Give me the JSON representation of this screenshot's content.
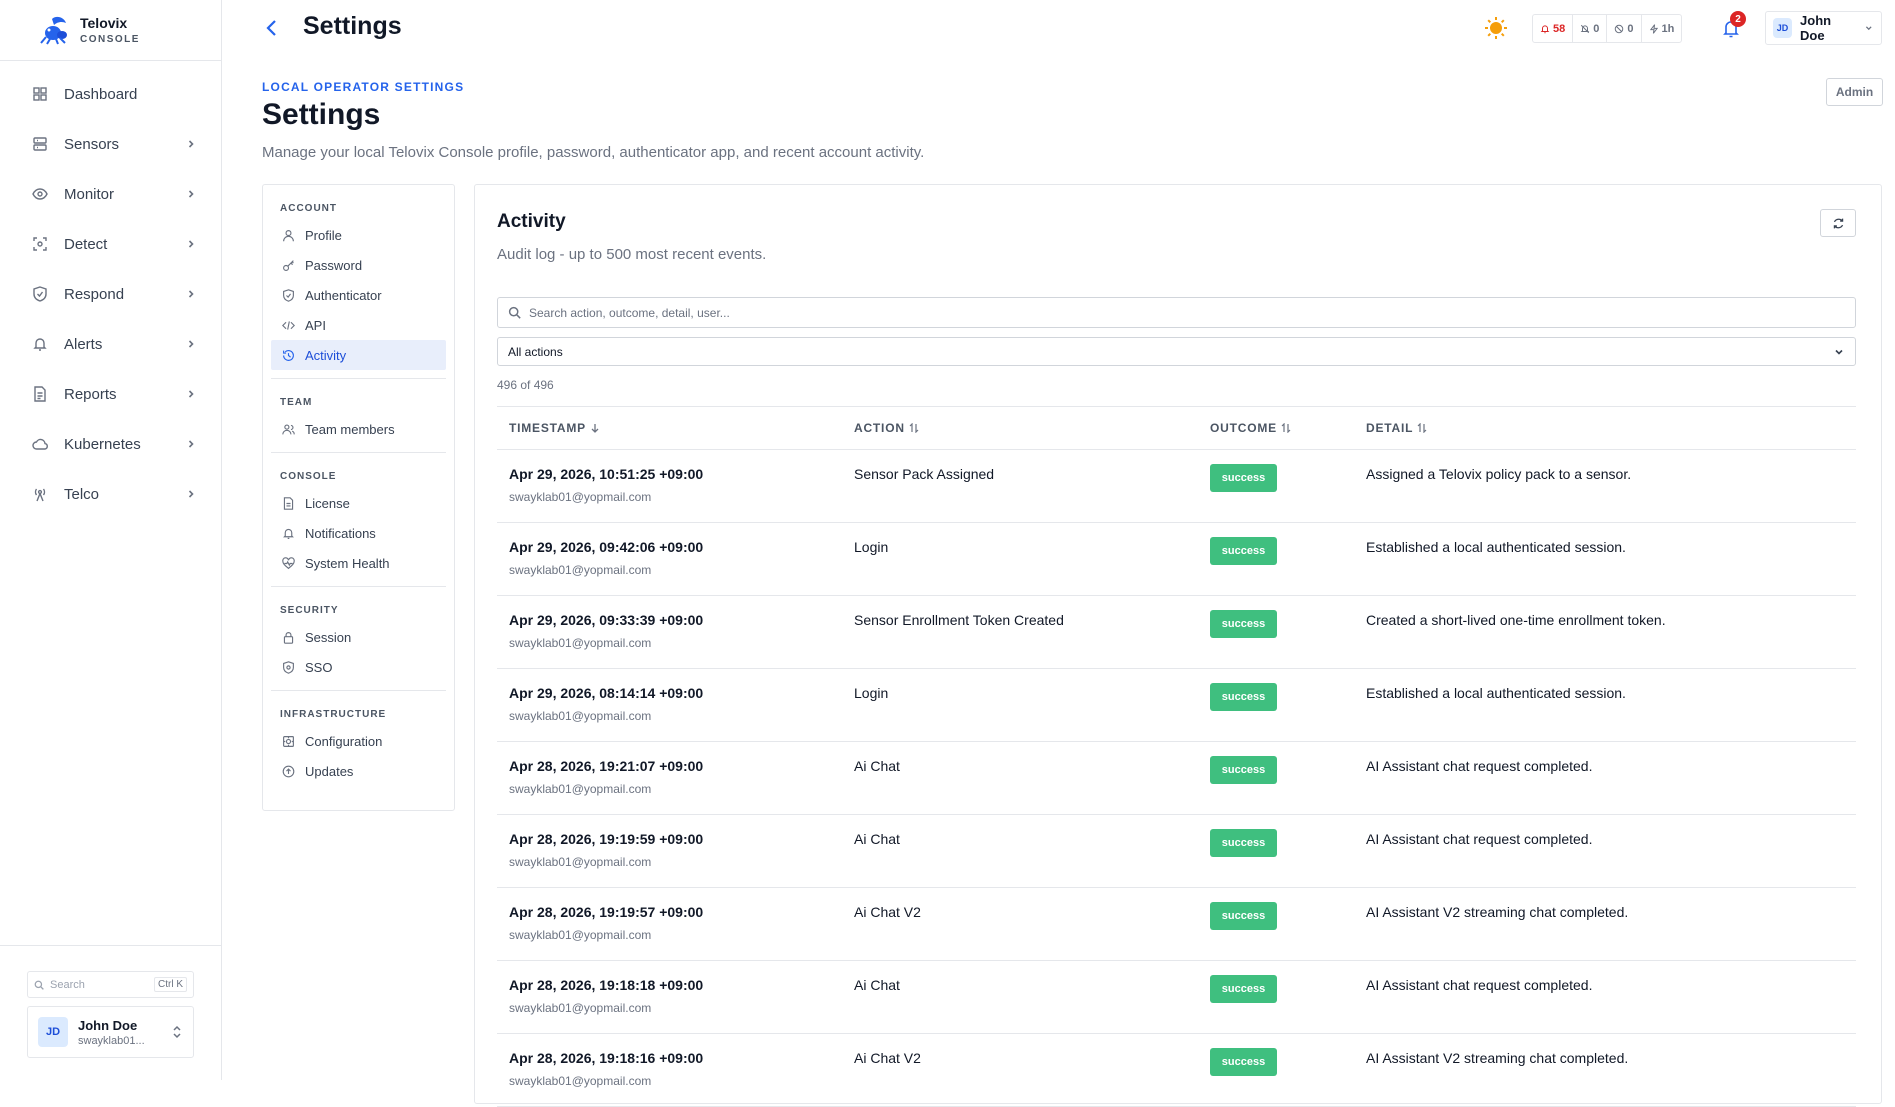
{
  "brand": {
    "name": "Telovix",
    "sub": "CONSOLE"
  },
  "sidebar": {
    "items": [
      {
        "label": "Dashboard",
        "icon": "grid-icon",
        "chevron": false
      },
      {
        "label": "Sensors",
        "icon": "server-icon",
        "chevron": true
      },
      {
        "label": "Monitor",
        "icon": "eye-icon",
        "chevron": true
      },
      {
        "label": "Detect",
        "icon": "scan-icon",
        "chevron": true
      },
      {
        "label": "Respond",
        "icon": "shield-icon",
        "chevron": true
      },
      {
        "label": "Alerts",
        "icon": "bell-icon",
        "chevron": true
      },
      {
        "label": "Reports",
        "icon": "file-icon",
        "chevron": true
      },
      {
        "label": "Kubernetes",
        "icon": "cloud-icon",
        "chevron": true
      },
      {
        "label": "Telco",
        "icon": "antenna-icon",
        "chevron": true
      }
    ],
    "search_placeholder": "Search",
    "search_shortcut": "Ctrl K",
    "user": {
      "initials": "JD",
      "name": "John Doe",
      "email": "swayklab01..."
    }
  },
  "topbar": {
    "title": "Settings",
    "stats": {
      "alerts": "58",
      "muted": "0",
      "blocked": "0",
      "window": "1h"
    },
    "notif_count": "2",
    "user": {
      "initials": "JD",
      "name": "John Doe"
    }
  },
  "header": {
    "eyebrow": "LOCAL OPERATOR SETTINGS",
    "title": "Settings",
    "description": "Manage your local Telovix Console profile, password, authenticator app, and recent account activity.",
    "role": "Admin"
  },
  "settings_nav": {
    "account": {
      "heading": "ACCOUNT",
      "items": [
        "Profile",
        "Password",
        "Authenticator",
        "API",
        "Activity"
      ]
    },
    "team": {
      "heading": "TEAM",
      "items": [
        "Team members"
      ]
    },
    "console": {
      "heading": "CONSOLE",
      "items": [
        "License",
        "Notifications",
        "System Health"
      ]
    },
    "security": {
      "heading": "SECURITY",
      "items": [
        "Session",
        "SSO"
      ]
    },
    "infrastructure": {
      "heading": "INFRASTRUCTURE",
      "items": [
        "Configuration",
        "Updates"
      ]
    },
    "active": "Activity"
  },
  "activity": {
    "title": "Activity",
    "subtitle": "Audit log - up to 500 most recent events.",
    "search_placeholder": "Search action, outcome, detail, user...",
    "filter_value": "All actions",
    "count": "496 of 496",
    "columns": [
      "TIMESTAMP",
      "ACTION",
      "OUTCOME",
      "DETAIL"
    ],
    "rows": [
      {
        "timestamp": "Apr 29, 2026, 10:51:25 +09:00",
        "user": "swayklab01@yopmail.com",
        "action": "Sensor Pack Assigned",
        "outcome": "success",
        "detail": "Assigned a Telovix policy pack to a sensor."
      },
      {
        "timestamp": "Apr 29, 2026, 09:42:06 +09:00",
        "user": "swayklab01@yopmail.com",
        "action": "Login",
        "outcome": "success",
        "detail": "Established a local authenticated session."
      },
      {
        "timestamp": "Apr 29, 2026, 09:33:39 +09:00",
        "user": "swayklab01@yopmail.com",
        "action": "Sensor Enrollment Token Created",
        "outcome": "success",
        "detail": "Created a short-lived one-time enrollment token."
      },
      {
        "timestamp": "Apr 29, 2026, 08:14:14 +09:00",
        "user": "swayklab01@yopmail.com",
        "action": "Login",
        "outcome": "success",
        "detail": "Established a local authenticated session."
      },
      {
        "timestamp": "Apr 28, 2026, 19:21:07 +09:00",
        "user": "swayklab01@yopmail.com",
        "action": "Ai Chat",
        "outcome": "success",
        "detail": "AI Assistant chat request completed."
      },
      {
        "timestamp": "Apr 28, 2026, 19:19:59 +09:00",
        "user": "swayklab01@yopmail.com",
        "action": "Ai Chat",
        "outcome": "success",
        "detail": "AI Assistant chat request completed."
      },
      {
        "timestamp": "Apr 28, 2026, 19:19:57 +09:00",
        "user": "swayklab01@yopmail.com",
        "action": "Ai Chat V2",
        "outcome": "success",
        "detail": "AI Assistant V2 streaming chat completed."
      },
      {
        "timestamp": "Apr 28, 2026, 19:18:18 +09:00",
        "user": "swayklab01@yopmail.com",
        "action": "Ai Chat",
        "outcome": "success",
        "detail": "AI Assistant chat request completed."
      },
      {
        "timestamp": "Apr 28, 2026, 19:18:16 +09:00",
        "user": "swayklab01@yopmail.com",
        "action": "Ai Chat V2",
        "outcome": "success",
        "detail": "AI Assistant V2 streaming chat completed."
      }
    ]
  },
  "colors": {
    "accent": "#2563eb",
    "success": "#3fbf7f",
    "danger": "#dc2626",
    "warning": "#f59e0b"
  }
}
